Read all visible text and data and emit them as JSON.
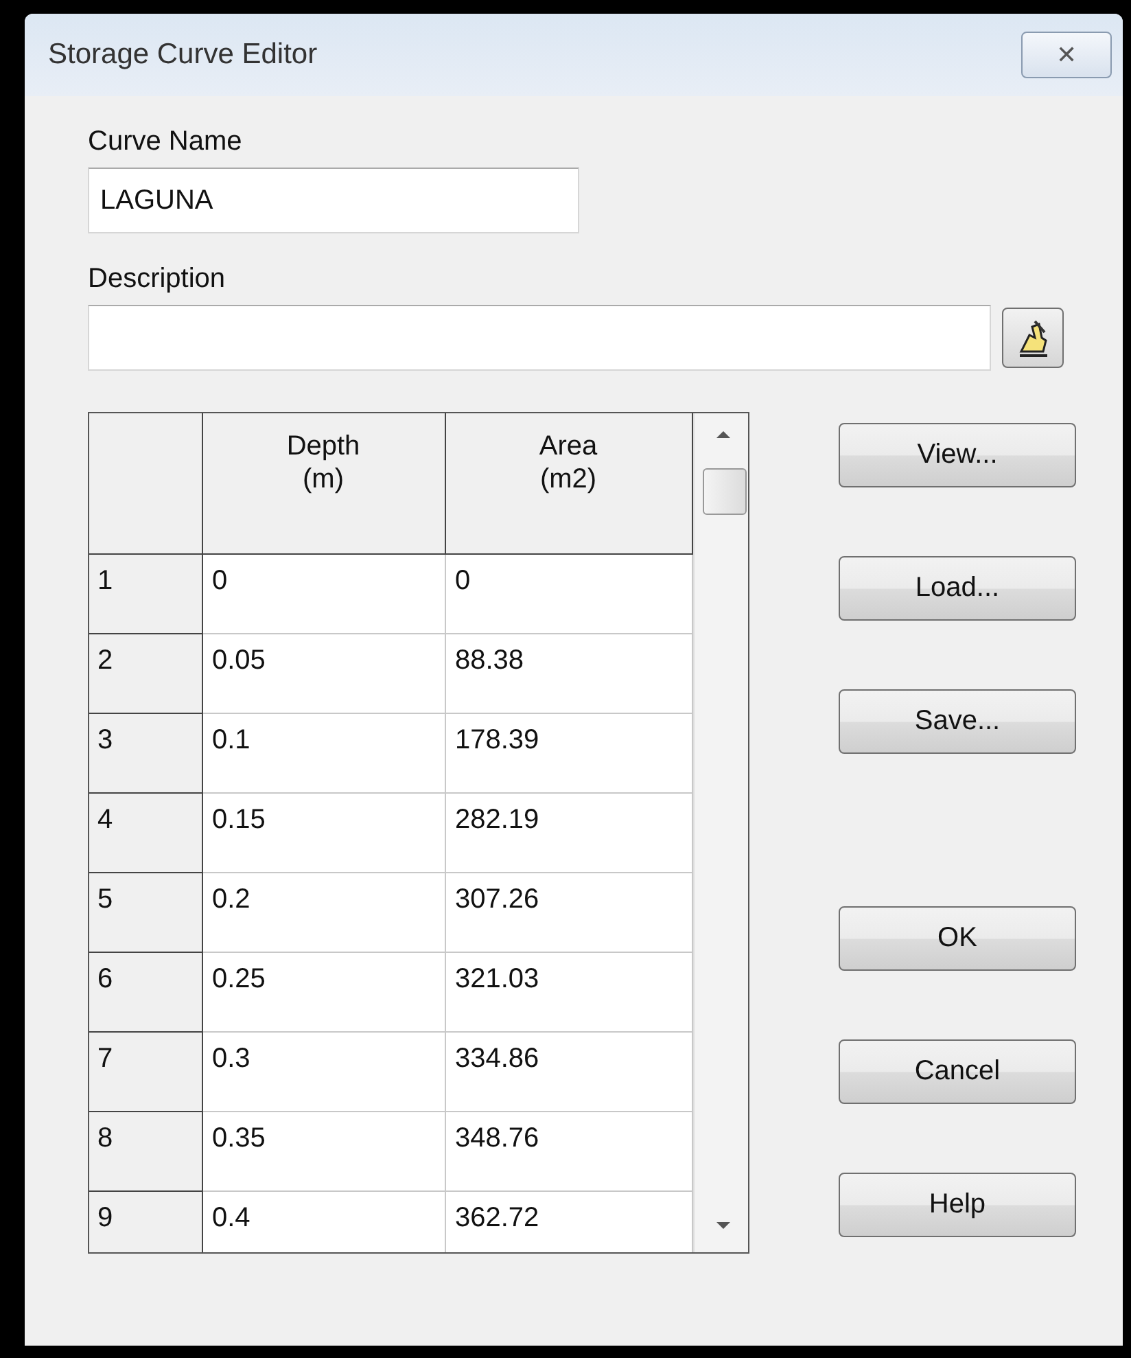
{
  "window": {
    "title": "Storage Curve Editor",
    "close": "✕"
  },
  "curve_name": {
    "label": "Curve Name",
    "value": "LAGUNA"
  },
  "description": {
    "label": "Description"
  },
  "table": {
    "columns": [
      {
        "title": "Depth",
        "unit": "(m)"
      },
      {
        "title": "Area",
        "unit": "(m2)"
      }
    ],
    "rows": [
      {
        "index": "1",
        "cells": [
          "0",
          "0"
        ]
      },
      {
        "index": "2",
        "cells": [
          "0.05",
          "88.38"
        ]
      },
      {
        "index": "3",
        "cells": [
          "0.1",
          "178.39"
        ]
      },
      {
        "index": "4",
        "cells": [
          "0.15",
          "282.19"
        ]
      },
      {
        "index": "5",
        "cells": [
          "0.2",
          "307.26"
        ]
      },
      {
        "index": "6",
        "cells": [
          "0.25",
          "321.03"
        ]
      },
      {
        "index": "7",
        "cells": [
          "0.3",
          "334.86"
        ]
      },
      {
        "index": "8",
        "cells": [
          "0.35",
          "348.76"
        ]
      },
      {
        "index": "9",
        "cells": [
          "0.4",
          "362.72"
        ]
      }
    ]
  },
  "file_buttons": [
    {
      "label": "View..."
    },
    {
      "label": "Load..."
    },
    {
      "label": "Save..."
    }
  ],
  "dialog_buttons": [
    {
      "label": "OK"
    },
    {
      "label": "Cancel"
    },
    {
      "label": "Help"
    }
  ]
}
